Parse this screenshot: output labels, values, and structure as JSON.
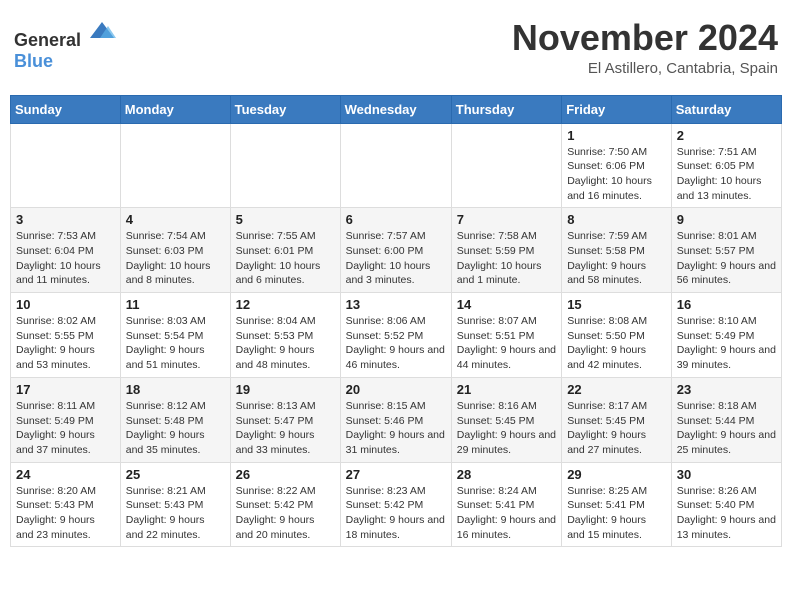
{
  "logo": {
    "text_general": "General",
    "text_blue": "Blue"
  },
  "title": {
    "month_year": "November 2024",
    "location": "El Astillero, Cantabria, Spain"
  },
  "weekdays": [
    "Sunday",
    "Monday",
    "Tuesday",
    "Wednesday",
    "Thursday",
    "Friday",
    "Saturday"
  ],
  "weeks": [
    [
      {
        "day": "",
        "info": ""
      },
      {
        "day": "",
        "info": ""
      },
      {
        "day": "",
        "info": ""
      },
      {
        "day": "",
        "info": ""
      },
      {
        "day": "",
        "info": ""
      },
      {
        "day": "1",
        "info": "Sunrise: 7:50 AM\nSunset: 6:06 PM\nDaylight: 10 hours and 16 minutes."
      },
      {
        "day": "2",
        "info": "Sunrise: 7:51 AM\nSunset: 6:05 PM\nDaylight: 10 hours and 13 minutes."
      }
    ],
    [
      {
        "day": "3",
        "info": "Sunrise: 7:53 AM\nSunset: 6:04 PM\nDaylight: 10 hours and 11 minutes."
      },
      {
        "day": "4",
        "info": "Sunrise: 7:54 AM\nSunset: 6:03 PM\nDaylight: 10 hours and 8 minutes."
      },
      {
        "day": "5",
        "info": "Sunrise: 7:55 AM\nSunset: 6:01 PM\nDaylight: 10 hours and 6 minutes."
      },
      {
        "day": "6",
        "info": "Sunrise: 7:57 AM\nSunset: 6:00 PM\nDaylight: 10 hours and 3 minutes."
      },
      {
        "day": "7",
        "info": "Sunrise: 7:58 AM\nSunset: 5:59 PM\nDaylight: 10 hours and 1 minute."
      },
      {
        "day": "8",
        "info": "Sunrise: 7:59 AM\nSunset: 5:58 PM\nDaylight: 9 hours and 58 minutes."
      },
      {
        "day": "9",
        "info": "Sunrise: 8:01 AM\nSunset: 5:57 PM\nDaylight: 9 hours and 56 minutes."
      }
    ],
    [
      {
        "day": "10",
        "info": "Sunrise: 8:02 AM\nSunset: 5:55 PM\nDaylight: 9 hours and 53 minutes."
      },
      {
        "day": "11",
        "info": "Sunrise: 8:03 AM\nSunset: 5:54 PM\nDaylight: 9 hours and 51 minutes."
      },
      {
        "day": "12",
        "info": "Sunrise: 8:04 AM\nSunset: 5:53 PM\nDaylight: 9 hours and 48 minutes."
      },
      {
        "day": "13",
        "info": "Sunrise: 8:06 AM\nSunset: 5:52 PM\nDaylight: 9 hours and 46 minutes."
      },
      {
        "day": "14",
        "info": "Sunrise: 8:07 AM\nSunset: 5:51 PM\nDaylight: 9 hours and 44 minutes."
      },
      {
        "day": "15",
        "info": "Sunrise: 8:08 AM\nSunset: 5:50 PM\nDaylight: 9 hours and 42 minutes."
      },
      {
        "day": "16",
        "info": "Sunrise: 8:10 AM\nSunset: 5:49 PM\nDaylight: 9 hours and 39 minutes."
      }
    ],
    [
      {
        "day": "17",
        "info": "Sunrise: 8:11 AM\nSunset: 5:49 PM\nDaylight: 9 hours and 37 minutes."
      },
      {
        "day": "18",
        "info": "Sunrise: 8:12 AM\nSunset: 5:48 PM\nDaylight: 9 hours and 35 minutes."
      },
      {
        "day": "19",
        "info": "Sunrise: 8:13 AM\nSunset: 5:47 PM\nDaylight: 9 hours and 33 minutes."
      },
      {
        "day": "20",
        "info": "Sunrise: 8:15 AM\nSunset: 5:46 PM\nDaylight: 9 hours and 31 minutes."
      },
      {
        "day": "21",
        "info": "Sunrise: 8:16 AM\nSunset: 5:45 PM\nDaylight: 9 hours and 29 minutes."
      },
      {
        "day": "22",
        "info": "Sunrise: 8:17 AM\nSunset: 5:45 PM\nDaylight: 9 hours and 27 minutes."
      },
      {
        "day": "23",
        "info": "Sunrise: 8:18 AM\nSunset: 5:44 PM\nDaylight: 9 hours and 25 minutes."
      }
    ],
    [
      {
        "day": "24",
        "info": "Sunrise: 8:20 AM\nSunset: 5:43 PM\nDaylight: 9 hours and 23 minutes."
      },
      {
        "day": "25",
        "info": "Sunrise: 8:21 AM\nSunset: 5:43 PM\nDaylight: 9 hours and 22 minutes."
      },
      {
        "day": "26",
        "info": "Sunrise: 8:22 AM\nSunset: 5:42 PM\nDaylight: 9 hours and 20 minutes."
      },
      {
        "day": "27",
        "info": "Sunrise: 8:23 AM\nSunset: 5:42 PM\nDaylight: 9 hours and 18 minutes."
      },
      {
        "day": "28",
        "info": "Sunrise: 8:24 AM\nSunset: 5:41 PM\nDaylight: 9 hours and 16 minutes."
      },
      {
        "day": "29",
        "info": "Sunrise: 8:25 AM\nSunset: 5:41 PM\nDaylight: 9 hours and 15 minutes."
      },
      {
        "day": "30",
        "info": "Sunrise: 8:26 AM\nSunset: 5:40 PM\nDaylight: 9 hours and 13 minutes."
      }
    ]
  ]
}
